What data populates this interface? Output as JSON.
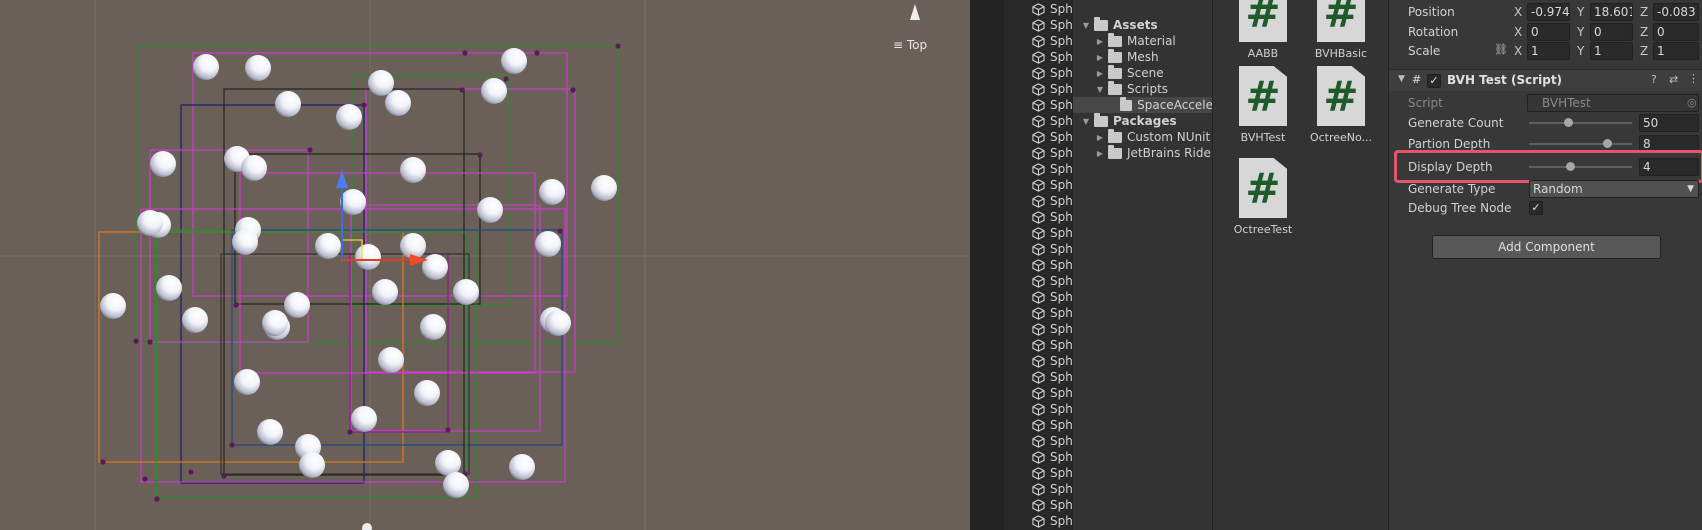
{
  "scene": {
    "view_label": "Top",
    "colors": {
      "background": "#6b6058"
    }
  },
  "hierarchy": {
    "item_label": "Sph",
    "item_count": 33
  },
  "project": {
    "tree": [
      {
        "label": "Assets",
        "bold": true,
        "expanded": true,
        "indent": 0
      },
      {
        "label": "Material",
        "bold": false,
        "expanded": false,
        "indent": 1
      },
      {
        "label": "Mesh",
        "bold": false,
        "expanded": false,
        "indent": 1
      },
      {
        "label": "Scene",
        "bold": false,
        "expanded": false,
        "indent": 1
      },
      {
        "label": "Scripts",
        "bold": false,
        "expanded": true,
        "indent": 1
      },
      {
        "label": "SpaceAccele",
        "bold": false,
        "expanded": null,
        "indent": 2,
        "selected": true
      },
      {
        "label": "Packages",
        "bold": true,
        "expanded": true,
        "indent": 0
      },
      {
        "label": "Custom NUnit",
        "bold": false,
        "expanded": false,
        "indent": 1
      },
      {
        "label": "JetBrains Rider",
        "bold": false,
        "expanded": false,
        "indent": 1
      }
    ]
  },
  "assets": {
    "items": [
      {
        "label": "AABB",
        "icon": "script-icon"
      },
      {
        "label": "BVHBasic",
        "icon": "script-icon"
      },
      {
        "label": "BVHTest",
        "icon": "script-icon"
      },
      {
        "label": "OctreeNo...",
        "icon": "script-icon"
      },
      {
        "label": "OctreeTest",
        "icon": "script-icon"
      }
    ],
    "icon_glyph": "#"
  },
  "inspector": {
    "transform": {
      "position_label": "Position",
      "rotation_label": "Rotation",
      "scale_label": "Scale",
      "axes": [
        "X",
        "Y",
        "Z"
      ],
      "position": [
        "-0.974",
        "18.6019",
        "-0.083"
      ],
      "rotation": [
        "0",
        "0",
        "0"
      ],
      "scale": [
        "1",
        "1",
        "1"
      ]
    },
    "component": {
      "title": "BVH Test (Script)",
      "enabled": true,
      "script_label": "Script",
      "script_value": "BVHTest",
      "generate_count_label": "Generate Count",
      "generate_count_value": "50",
      "generate_count_level": 0.38,
      "partion_depth_label": "Partion Depth",
      "partion_depth_value": "8",
      "partion_depth_level": 0.76,
      "display_depth_label": "Display Depth",
      "display_depth_value": "4",
      "display_depth_level": 0.4,
      "generate_type_label": "Generate Type",
      "generate_type_value": "Random",
      "debug_tree_node_label": "Debug Tree Node",
      "debug_tree_node_checked": true,
      "add_component_label": "Add Component"
    },
    "colors": {
      "highlight": "#e2576a"
    }
  }
}
